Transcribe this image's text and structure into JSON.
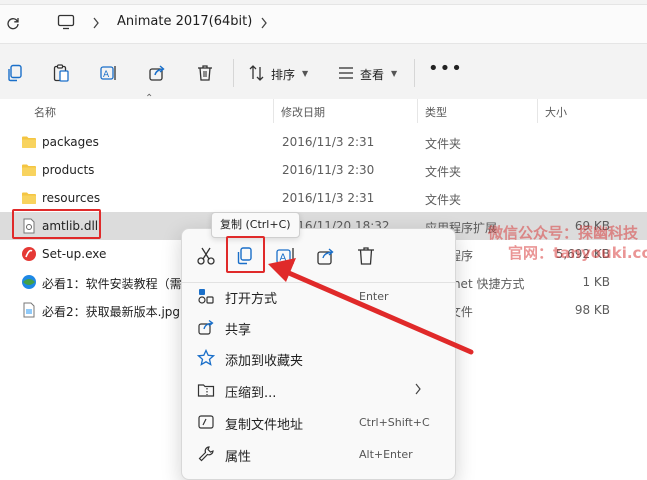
{
  "address": {
    "breadcrumb": "Animate 2017(64bit)"
  },
  "toolbar": {
    "sort_label": "排序",
    "view_label": "查看",
    "more_label": "•••"
  },
  "columns": {
    "name": "名称",
    "date": "修改日期",
    "type": "类型",
    "size": "大小"
  },
  "files": [
    {
      "name": "packages",
      "date": "2016/11/3 2:31",
      "type": "文件夹",
      "size": "",
      "icon": "folder-icon"
    },
    {
      "name": "products",
      "date": "2016/11/3 2:30",
      "type": "文件夹",
      "size": "",
      "icon": "folder-icon"
    },
    {
      "name": "resources",
      "date": "2016/11/3 2:31",
      "type": "文件夹",
      "size": "",
      "icon": "folder-icon"
    },
    {
      "name": "amtlib.dll",
      "date": "2016/11/20 18:32",
      "type": "应用程序扩展",
      "size": "69 KB",
      "icon": "dll-file-icon"
    },
    {
      "name": "Set-up.exe",
      "date": "",
      "type": "应用程序",
      "size": "5,692 KB",
      "icon": "exe-file-icon"
    },
    {
      "name": "必看1：软件安装教程（需",
      "date": "",
      "type": "Internet 快捷方式",
      "size": "1 KB",
      "icon": "url-shortcut-icon"
    },
    {
      "name": "必看2：获取最新版本.jpg",
      "date": "",
      "type": "JPG 文件",
      "size": "98 KB",
      "icon": "image-file-icon"
    }
  ],
  "tooltip": "复制 (Ctrl+C)",
  "context_menu": {
    "items": [
      {
        "label": "打开方式",
        "shortcut": "Enter",
        "icon": "open-with-icon"
      },
      {
        "label": "共享",
        "shortcut": "",
        "icon": "share-icon"
      },
      {
        "label": "添加到收藏夹",
        "shortcut": "",
        "icon": "star-icon"
      },
      {
        "label": "压缩到...",
        "shortcut": "",
        "icon": "zip-folder-icon"
      },
      {
        "label": "复制文件地址",
        "shortcut": "Ctrl+Shift+C",
        "icon": "copy-path-icon"
      },
      {
        "label": "属性",
        "shortcut": "Alt+Enter",
        "icon": "wrench-icon"
      }
    ]
  },
  "watermark": {
    "line1": "微信公众号：探幽科技",
    "line2": "官网：tanyouki.com"
  },
  "colors": {
    "highlight_red": "#e02a2a",
    "folder_yellow": "#f4c542",
    "selected_row": "#dcdcdc"
  }
}
